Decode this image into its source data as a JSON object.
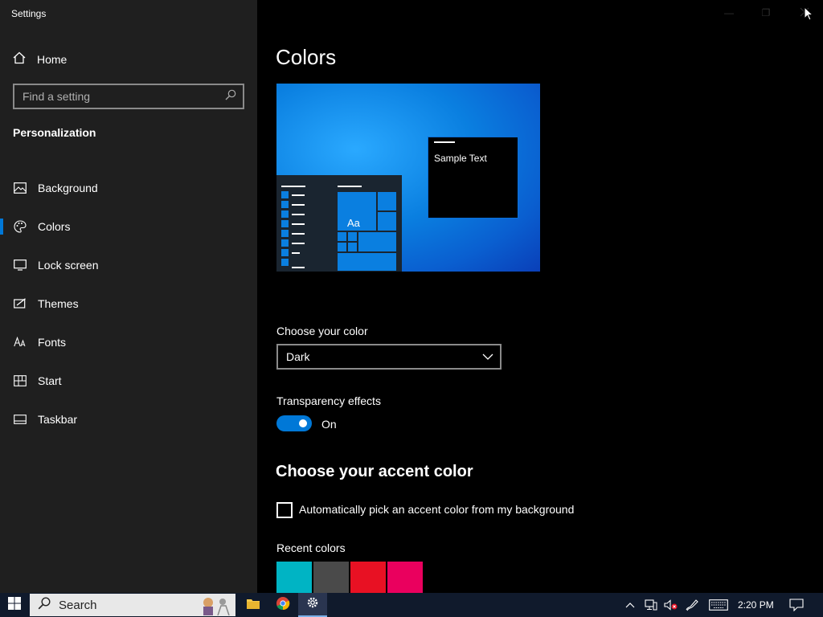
{
  "window": {
    "title": "Settings",
    "minimize_glyph": "—",
    "maximize_glyph": "❐"
  },
  "sidebar": {
    "home_label": "Home",
    "search": {
      "placeholder": "Find a setting",
      "value": ""
    },
    "section_title": "Personalization",
    "items": [
      {
        "label": "Background",
        "icon": "image-icon",
        "active": false
      },
      {
        "label": "Colors",
        "icon": "palette-icon",
        "active": true
      },
      {
        "label": "Lock screen",
        "icon": "lock-screen-icon",
        "active": false
      },
      {
        "label": "Themes",
        "icon": "themes-icon",
        "active": false
      },
      {
        "label": "Fonts",
        "icon": "fonts-icon",
        "active": false
      },
      {
        "label": "Start",
        "icon": "start-icon",
        "active": false
      },
      {
        "label": "Taskbar",
        "icon": "taskbar-icon",
        "active": false
      }
    ]
  },
  "main": {
    "page_title": "Colors",
    "preview": {
      "sample_text": "Sample Text",
      "tile_text": "Aa"
    },
    "choose_color": {
      "label": "Choose your color",
      "value": "Dark"
    },
    "transparency": {
      "label": "Transparency effects",
      "state": "On",
      "enabled": true
    },
    "accent": {
      "heading": "Choose your accent color",
      "auto_pick_label": "Automatically pick an accent color from my background",
      "auto_pick_checked": false,
      "recent_label": "Recent colors",
      "recent_colors": [
        "#00b4c4",
        "#4a4a4a",
        "#e81123",
        "#ea005e"
      ]
    }
  },
  "taskbar": {
    "search_label": "Search",
    "apps": [
      "file-explorer-icon",
      "chrome-icon",
      "settings-icon"
    ],
    "clock": "2:20 PM"
  },
  "colors": {
    "accent": "#0078d7",
    "sidebar_bg": "#1f1f1f",
    "main_bg": "#000000",
    "taskbar_bg": "#101a2c"
  }
}
